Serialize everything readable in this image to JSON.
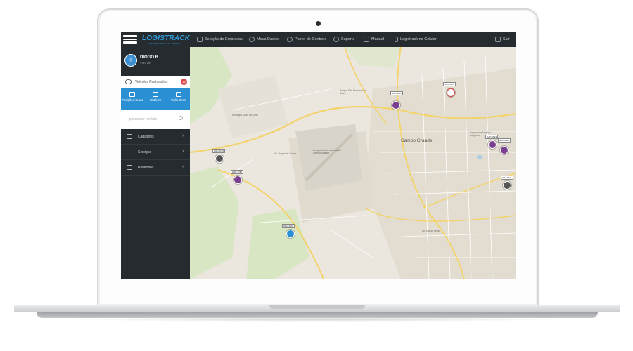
{
  "app": {
    "logo_main": "LOGISTRACK",
    "logo_sub": "RASTREAMENTO & LOGÍSTICA"
  },
  "topnav": {
    "items": [
      {
        "label": "Seleção de Empresas",
        "icon": "truck-icon"
      },
      {
        "label": "Meus Dados",
        "icon": "user-icon"
      },
      {
        "label": "Painel de Controle",
        "icon": "dashboard-icon"
      },
      {
        "label": "Suporte",
        "icon": "headset-icon"
      },
      {
        "label": "Manual",
        "icon": "book-icon"
      },
      {
        "label": "Logistrack no Celular",
        "icon": "phone-icon"
      }
    ],
    "logout": "Sair"
  },
  "user": {
    "name": "DIOGO B.",
    "role": "VISITOR"
  },
  "sidebar": {
    "vehicles_label": "Veículos Rastreados",
    "vehicles_count": "15",
    "tabs": [
      {
        "label": "Posições Atuais"
      },
      {
        "label": "Histórico"
      },
      {
        "label": "Visão Geral"
      }
    ],
    "search_placeholder": "pesquisar veículo",
    "menu": [
      {
        "label": "Cadastros"
      },
      {
        "label": "Serviços"
      },
      {
        "label": "Relatórios"
      }
    ]
  },
  "map": {
    "city_label": "Campo Grande",
    "labels": [
      {
        "text": "Aeroporto Internacional de Campo Grande"
      },
      {
        "text": "Parque das Nações Indígenas"
      },
      {
        "text": "Parque São Francisco de Sales"
      },
      {
        "text": "Embrapa Gado de Corte"
      },
      {
        "text": "Av. Duque de Caxias"
      },
      {
        "text": "Av. Afonso Pena"
      }
    ],
    "vehicles": [
      {
        "plate": "HRL-6810",
        "color": "#7a3f8f"
      },
      {
        "plate": "HRL-4570",
        "color": "#e0474b"
      },
      {
        "plate": "QAP-1623",
        "color": "#7a3f8f"
      },
      {
        "plate": "NRH-4420",
        "color": "#7a3f8f"
      },
      {
        "plate": "HRU-0216",
        "color": "#555555"
      },
      {
        "plate": "HRP-7780",
        "color": "#7a3f8f"
      },
      {
        "plate": "NRJ-3821",
        "color": "#555555"
      },
      {
        "plate": "OBC-3501",
        "color": "#2a8fd3"
      }
    ]
  }
}
